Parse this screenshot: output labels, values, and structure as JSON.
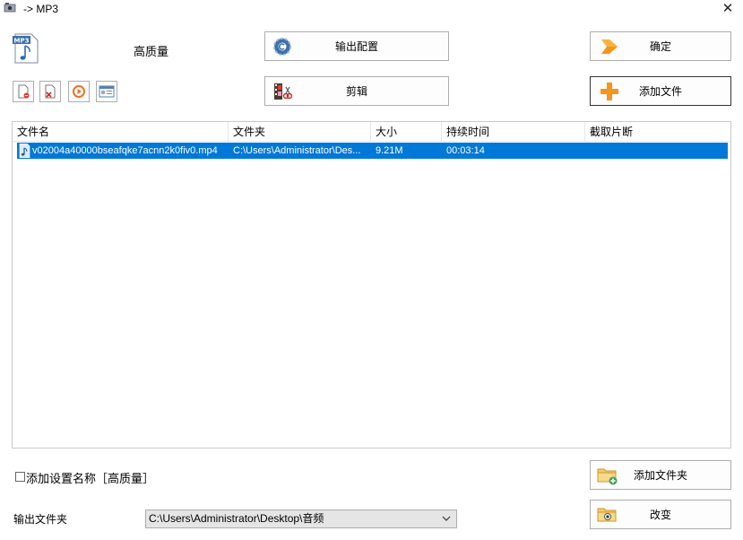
{
  "window": {
    "title": "-> MP3",
    "close_glyph": "✕"
  },
  "top": {
    "format_icon": "mp3-file-icon",
    "format_icon_text": "MP3",
    "quality_label": "高质量"
  },
  "toolbar": {
    "output_config_label": "输出配置",
    "edit_label": "剪辑",
    "ok_label": "确定",
    "add_file_label": "添加文件",
    "small_buttons": [
      "remove-item-icon",
      "clear-list-icon",
      "play-icon",
      "info-icon"
    ]
  },
  "list": {
    "columns": [
      "文件名",
      "文件夹",
      "大小",
      "持续时间",
      "截取片断"
    ],
    "rows": [
      {
        "filename": "v02004a40000bseafqke7acnn2k0fiv0.mp4",
        "folder": "C:\\Users\\Administrator\\Des...",
        "size": "9.21M",
        "duration": "00:03:14",
        "clip": ""
      }
    ]
  },
  "bottom": {
    "add_setting_name_label": "添加设置名称［高质量］",
    "add_setting_name_checked": false,
    "output_folder_label": "输出文件夹",
    "output_folder_value": "C:\\Users\\Administrator\\Desktop\\音频",
    "add_folder_label": "添加文件夹",
    "change_label": "改变"
  },
  "colors": {
    "selection": "#0078d7",
    "button_border": "#adadad",
    "accent_orange": "#f7941d"
  }
}
